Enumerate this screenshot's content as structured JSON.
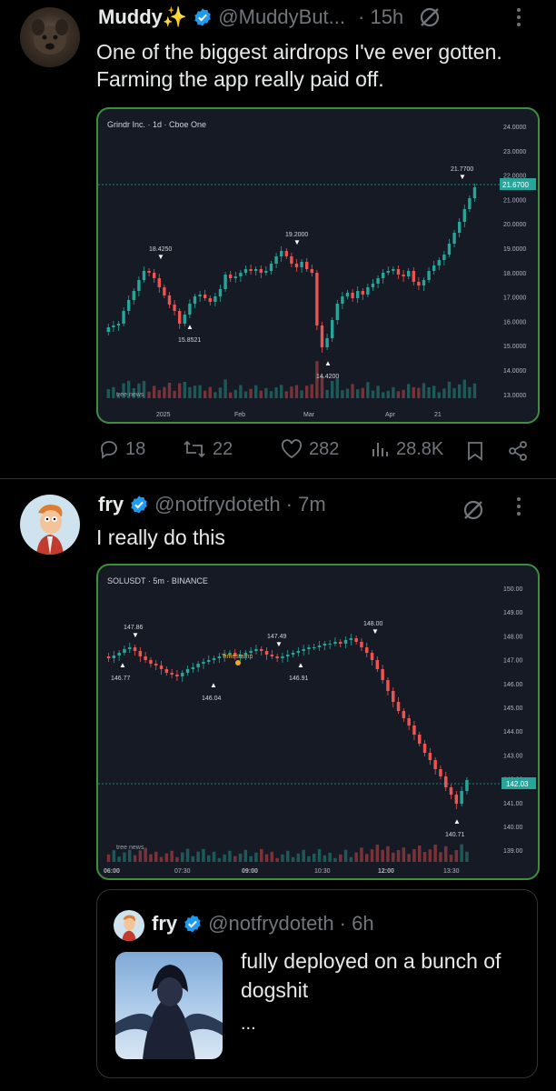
{
  "post1": {
    "name": "Muddy✨",
    "handle": "@MuddyBut...",
    "time": "· 15h",
    "text": "One of the biggest airdrops I've ever gotten. Farming the app really paid off.",
    "chart": {
      "title": "Grindr Inc. · 1d · Cboe One",
      "price_labels": [
        "24.0000",
        "23.0000",
        "22.0000",
        "21.0000",
        "20.0000",
        "19.0000",
        "18.0000",
        "17.0000",
        "16.0000",
        "15.0000",
        "14.0000",
        "13.0000"
      ],
      "last_price": "21.6700",
      "time_labels": [
        "2025",
        "Feb",
        "Mar",
        "Apr",
        "21"
      ],
      "annotations": [
        "18.4250",
        "15.8521",
        "19.2000",
        "14.4200",
        "21.7700"
      ],
      "watermark": "tree news"
    },
    "actions": {
      "replies": "18",
      "reposts": "22",
      "likes": "282",
      "views": "28.8K"
    }
  },
  "post2": {
    "name": "fry",
    "handle": "@notfrydoteth",
    "time": "· 7m",
    "text": "I really do this",
    "chart": {
      "title": "SOLUSDT · 5m · BINANCE",
      "price_labels": [
        "150.00",
        "149.00",
        "148.00",
        "147.00",
        "146.00",
        "145.00",
        "144.00",
        "143.00",
        "142.00",
        "141.00",
        "140.00",
        "139.00"
      ],
      "last_price": "142.03",
      "time_labels": [
        "06:00",
        "07:30",
        "09:00",
        "10:30",
        "12:00",
        "13:30"
      ],
      "annotations": [
        "147.86",
        "146.77",
        "146.04",
        "147.49",
        "146.91",
        "148.00",
        "140.71"
      ],
      "marker_label": "Timestamp",
      "watermark": "tree news"
    },
    "quote": {
      "name": "fry",
      "handle": "@notfrydoteth",
      "time": "· 6h",
      "text": "fully deployed on a bunch of dogshit",
      "ellipsis": "..."
    }
  },
  "colors": {
    "up": "#26a69a",
    "down": "#ef5350",
    "accent": "#1d9bf0",
    "border": "#3d8f3d"
  }
}
